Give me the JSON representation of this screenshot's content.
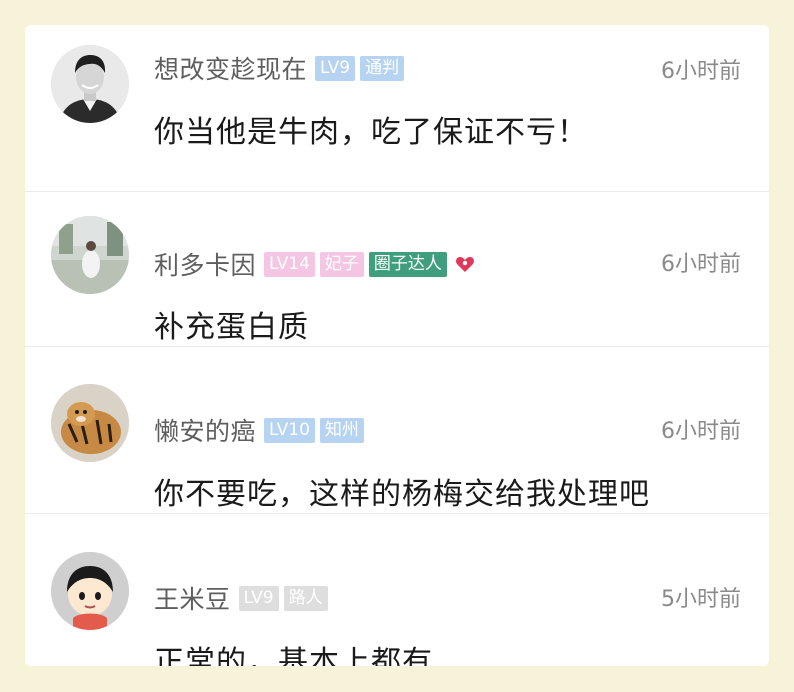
{
  "comments": [
    {
      "username": "想改变趁现在",
      "badges": [
        {
          "label": "LV9",
          "bg": "#b7d3f2",
          "fg": "#ffffff"
        },
        {
          "label": "通判",
          "bg": "#b7d3f2",
          "fg": "#ffffff"
        }
      ],
      "time": "6小时前",
      "text": "你当他是牛肉，吃了保证不亏！",
      "avatar_icon": "man-portrait-avatar"
    },
    {
      "username": "利多卡因",
      "badges": [
        {
          "label": "LV14",
          "bg": "#f4c6e3",
          "fg": "#ffffff"
        },
        {
          "label": "妃子",
          "bg": "#f4c6e3",
          "fg": "#ffffff"
        },
        {
          "label": "圈子达人",
          "bg": "#3f9e7d",
          "fg": "#ffffff"
        }
      ],
      "has_heart_badge": true,
      "heart_color": "#e0385a",
      "time": "6小时前",
      "text": "补充蛋白质",
      "avatar_icon": "garden-photo-avatar"
    },
    {
      "username": "懒安的癌",
      "badges": [
        {
          "label": "LV10",
          "bg": "#b7d3f2",
          "fg": "#ffffff"
        },
        {
          "label": "知州",
          "bg": "#b7d3f2",
          "fg": "#ffffff"
        }
      ],
      "time": "6小时前",
      "text": "你不要吃，这样的杨梅交给我处理吧",
      "avatar_icon": "tiger-avatar"
    },
    {
      "username": "王米豆",
      "badges": [
        {
          "label": "LV9",
          "bg": "#dedede",
          "fg": "#ffffff"
        },
        {
          "label": "路人",
          "bg": "#dedede",
          "fg": "#ffffff"
        }
      ],
      "time": "5小时前",
      "text": "正常的，基本上都有",
      "avatar_icon": "cartoon-face-avatar"
    }
  ]
}
